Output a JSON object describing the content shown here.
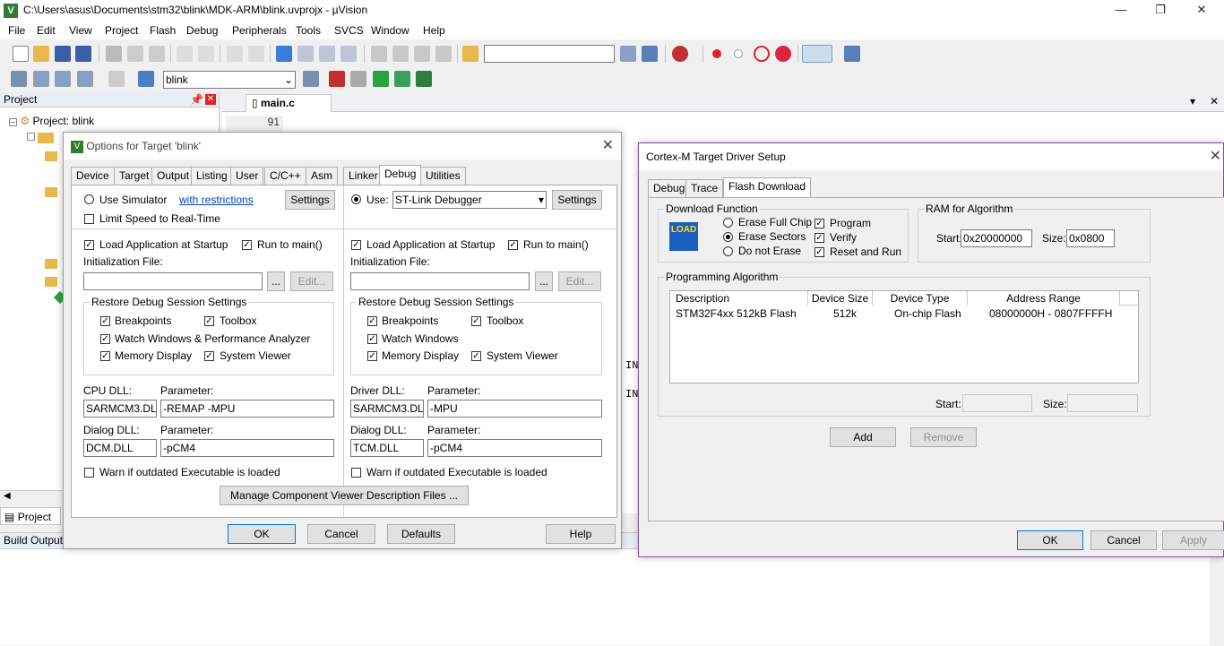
{
  "window": {
    "title": "C:\\Users\\asus\\Documents\\stm32\\blink\\MDK-ARM\\blink.uvprojx - µVision",
    "minimize": "—",
    "restore": "❐",
    "close": "✕"
  },
  "menu": [
    "File",
    "Edit",
    "View",
    "Project",
    "Flash",
    "Debug",
    "Peripherals",
    "Tools",
    "SVCS",
    "Window",
    "Help"
  ],
  "toolbar2": {
    "target_select": "blink"
  },
  "project_pane": {
    "title": "Project",
    "root": "Project: blink",
    "bottom_tab": "Project"
  },
  "editor": {
    "tab": "main.c",
    "line_number": "91",
    "frag1": "IN_",
    "frag2": "IN_"
  },
  "build_output": {
    "title": "Build Output"
  },
  "options_dialog": {
    "title": "Options for Target 'blink'",
    "tabs": [
      "Device",
      "Target",
      "Output",
      "Listing",
      "User",
      "C/C++",
      "Asm",
      "Linker",
      "Debug",
      "Utilities"
    ],
    "left": {
      "use_simulator": "Use Simulator",
      "with_restrictions": "with restrictions",
      "settings": "Settings",
      "limit_speed": "Limit Speed to Real-Time",
      "load_app": "Load Application at Startup",
      "run_to_main": "Run to main()",
      "init_file": "Initialization File:",
      "browse": "...",
      "edit": "Edit...",
      "restore_group": "Restore Debug Session Settings",
      "breakpoints": "Breakpoints",
      "toolbox": "Toolbox",
      "watch": "Watch Windows & Performance Analyzer",
      "memory": "Memory Display",
      "system_viewer": "System Viewer",
      "cpu_dll": "CPU DLL:",
      "parameter": "Parameter:",
      "cpu_dll_value": "SARMCM3.DLL",
      "cpu_param_value": "-REMAP -MPU",
      "dialog_dll": "Dialog DLL:",
      "dialog_dll_value": "DCM.DLL",
      "dialog_param_value": "-pCM4",
      "warn": "Warn if outdated Executable is loaded"
    },
    "right": {
      "use": "Use:",
      "debugger": "ST-Link Debugger",
      "settings": "Settings",
      "load_app": "Load Application at Startup",
      "run_to_main": "Run to main()",
      "init_file": "Initialization File:",
      "browse": "...",
      "edit": "Edit...",
      "restore_group": "Restore Debug Session Settings",
      "breakpoints": "Breakpoints",
      "toolbox": "Toolbox",
      "watch": "Watch Windows",
      "memory": "Memory Display",
      "system_viewer": "System Viewer",
      "driver_dll": "Driver DLL:",
      "parameter": "Parameter:",
      "driver_dll_value": "SARMCM3.DLL",
      "driver_param_value": "-MPU",
      "dialog_dll": "Dialog DLL:",
      "dialog_dll_value": "TCM.DLL",
      "dialog_param_value": "-pCM4",
      "warn": "Warn if outdated Executable is loaded"
    },
    "manage_button": "Manage Component Viewer Description Files ...",
    "ok": "OK",
    "cancel": "Cancel",
    "defaults": "Defaults",
    "help": "Help"
  },
  "driver_dialog": {
    "title": "Cortex-M Target Driver Setup",
    "tabs": [
      "Debug",
      "Trace",
      "Flash Download"
    ],
    "download_function": "Download Function",
    "load_icon_text": "LOAD",
    "erase_full": "Erase Full Chip",
    "erase_sectors": "Erase Sectors",
    "do_not_erase": "Do not Erase",
    "program": "Program",
    "verify": "Verify",
    "reset_run": "Reset and Run",
    "ram_group": "RAM for Algorithm",
    "start_label": "Start:",
    "start_value": "0x20000000",
    "size_label": "Size:",
    "size_value": "0x0800",
    "prog_algo": "Programming Algorithm",
    "columns": [
      "Description",
      "Device Size",
      "Device Type",
      "Address Range"
    ],
    "rows": [
      {
        "description": "STM32F4xx 512kB Flash",
        "size": "512k",
        "type": "On-chip Flash",
        "range": "08000000H - 0807FFFFH"
      }
    ],
    "algo_start": "Start:",
    "algo_size": "Size:",
    "add": "Add",
    "remove": "Remove",
    "ok": "OK",
    "cancel": "Cancel",
    "apply": "Apply"
  }
}
